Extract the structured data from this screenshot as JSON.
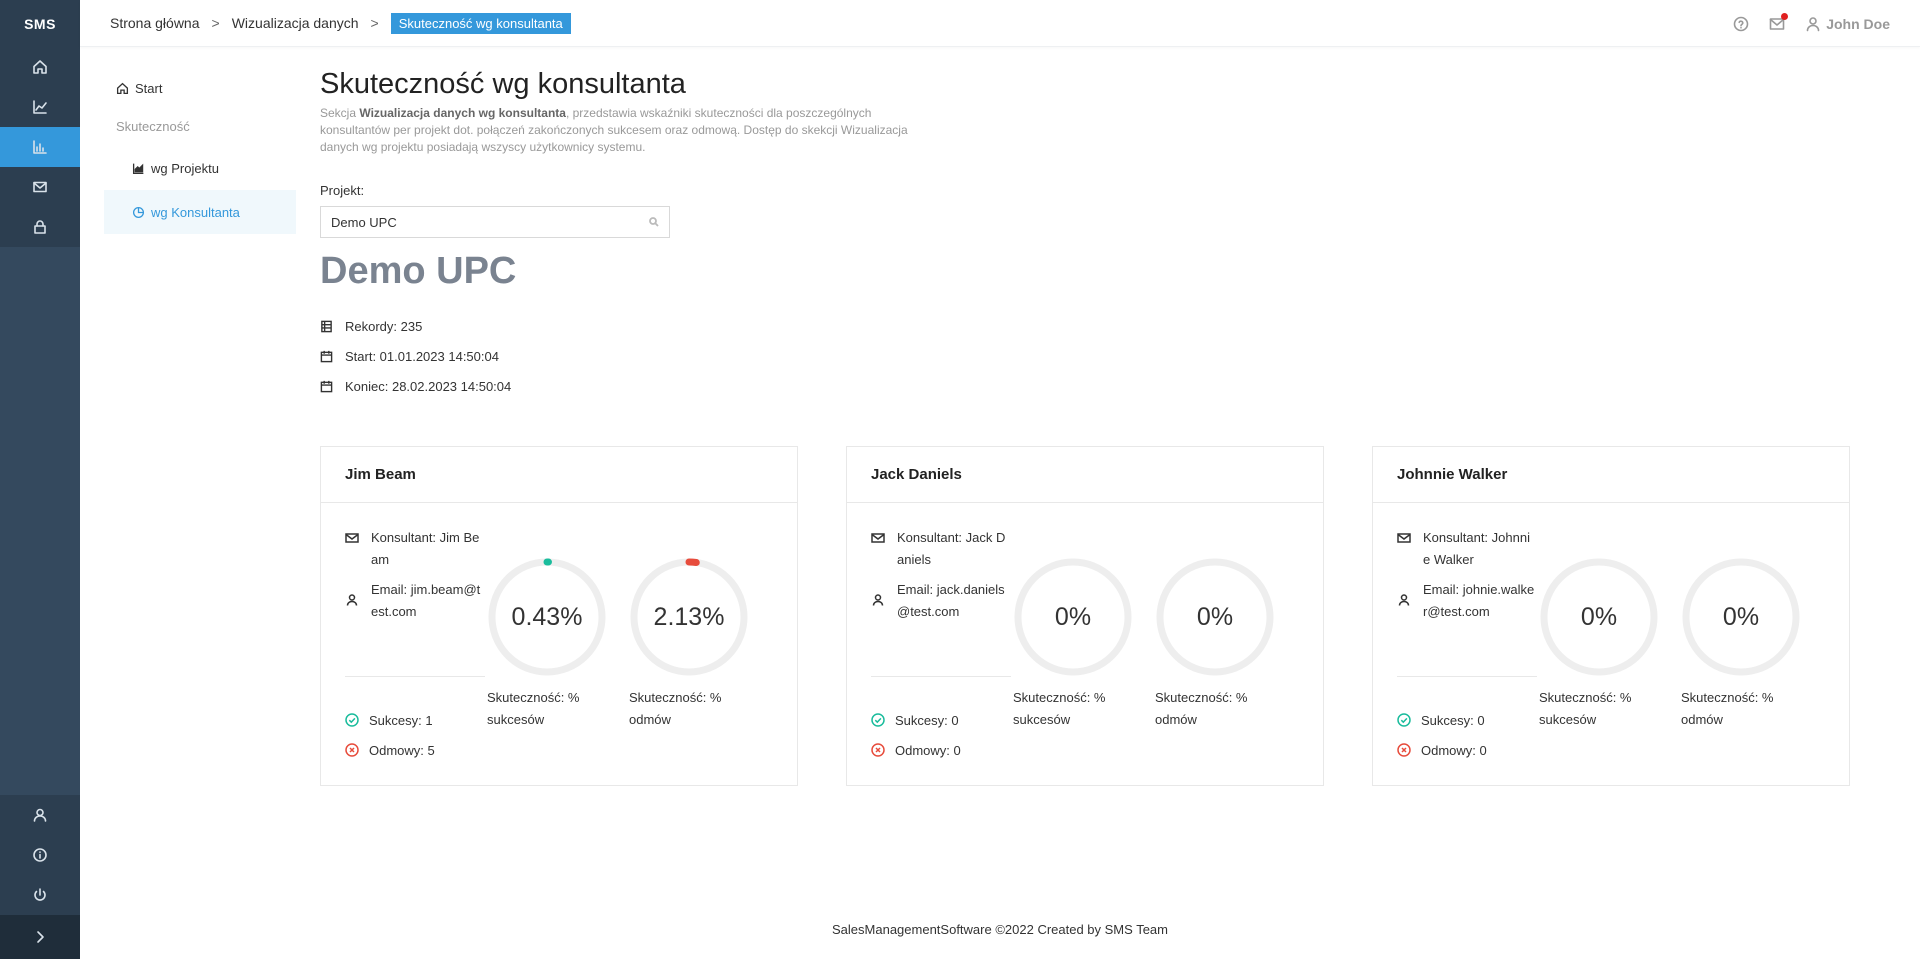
{
  "app": {
    "logo": "SMS"
  },
  "breadcrumb": {
    "items": [
      "Strona główna",
      "Wizualizacja danych"
    ],
    "separator": ">",
    "active": "Skuteczność wg konsultanta"
  },
  "user": {
    "name": "John Doe"
  },
  "subnav": {
    "start": "Start",
    "section": "Skuteczność",
    "by_project": "wg Projektu",
    "by_consultant": "wg Konsultanta"
  },
  "page": {
    "title": "Skuteczność wg konsultanta",
    "desc_prefix": "Sekcja ",
    "desc_bold": "Wizualizacja danych wg konsultanta",
    "desc_rest": ", przedstawia wskaźniki skuteczności dla poszczególnych konsultantów per projekt dot. połączeń zakończonych sukcesem oraz odmową. Dostęp do skekcji Wizualizacja danych wg projektu posiadają wszyscy użytkownicy systemu."
  },
  "project": {
    "label": "Projekt:",
    "value": "Demo UPC",
    "name": "Demo UPC",
    "records": "Rekordy: 235",
    "start": "Start: 01.01.2023 14:50:04",
    "end": "Koniec: 28.02.2023 14:50:04"
  },
  "consultants": [
    {
      "name": "Jim Beam",
      "consultant": "Konsultant: Jim Beam",
      "email": "Email: jim.beam@test.com",
      "success_pct": 0.43,
      "success_label": "0.43%",
      "reject_pct": 2.13,
      "reject_label": "2.13%",
      "success_caption": "Skuteczność: % sukcesów",
      "reject_caption": "Skuteczność: % odmów",
      "successes": "Sukcesy: 1",
      "rejections": "Odmowy: 5"
    },
    {
      "name": "Jack Daniels",
      "consultant": "Konsultant: Jack Daniels",
      "email": "Email: jack.daniels@test.com",
      "success_pct": 0,
      "success_label": "0%",
      "reject_pct": 0,
      "reject_label": "0%",
      "success_caption": "Skuteczność: % sukcesów",
      "reject_caption": "Skuteczność: % odmów",
      "successes": "Sukcesy: 0",
      "rejections": "Odmowy: 0"
    },
    {
      "name": "Johnnie Walker",
      "consultant": "Konsultant: Johnnie Walker",
      "email": "Email: johnie.walker@test.com",
      "success_pct": 0,
      "success_label": "0%",
      "reject_pct": 0,
      "reject_label": "0%",
      "success_caption": "Skuteczność: % sukcesów",
      "reject_caption": "Skuteczność: % odmów",
      "successes": "Sukcesy: 0",
      "rejections": "Odmowy: 0"
    }
  ],
  "colors": {
    "success": "#1abc9c",
    "reject": "#e74c3c",
    "track": "#eeeeee",
    "accent": "#3498db"
  },
  "footer": "SalesManagementSoftware ©2022 Created by SMS Team"
}
